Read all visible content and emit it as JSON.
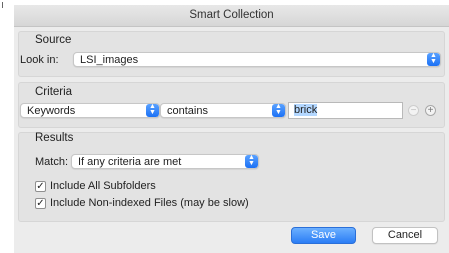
{
  "window": {
    "title": "Smart Collection"
  },
  "source": {
    "section_label": "Source",
    "look_in_label": "Look in:",
    "look_in_value": "LSI_images"
  },
  "criteria": {
    "section_label": "Criteria",
    "field_value": "Keywords",
    "operator_value": "contains",
    "text_value": "brick",
    "remove_label": "−",
    "add_label": "+"
  },
  "results": {
    "section_label": "Results",
    "match_label": "Match:",
    "match_value": "If any criteria are met",
    "include_subfolders": {
      "label": "Include All Subfolders",
      "checked": true
    },
    "include_nonindexed": {
      "label": "Include Non-indexed Files (may be slow)",
      "checked": true
    }
  },
  "buttons": {
    "save": "Save",
    "cancel": "Cancel"
  },
  "colors": {
    "accent": "#1b70f5",
    "selection": "#b3d7ff"
  },
  "icons": {
    "stepper": "updown-chevron-icon",
    "checkmark": "checkmark-icon"
  }
}
